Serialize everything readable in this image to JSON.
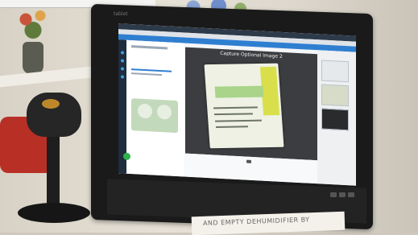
{
  "scene": {
    "description_tags": [
      "photo-of-monitor",
      "barcode-scanner"
    ],
    "colors": {
      "app_header": "#2f7fd1",
      "viewer_bg": "#3b3d40",
      "label_yellow": "#d9df4a",
      "scanner_lens": "#d99a2b"
    }
  },
  "monitor": {
    "brand": "tablet",
    "app": {
      "header_title": "",
      "viewer_title": "Capture Optional Image 2"
    }
  },
  "desk_sign": {
    "text": "AND EMPTY DEHUMIDIFIER BY"
  },
  "icons": [
    "scanner-icon",
    "green-action-button-icon"
  ]
}
